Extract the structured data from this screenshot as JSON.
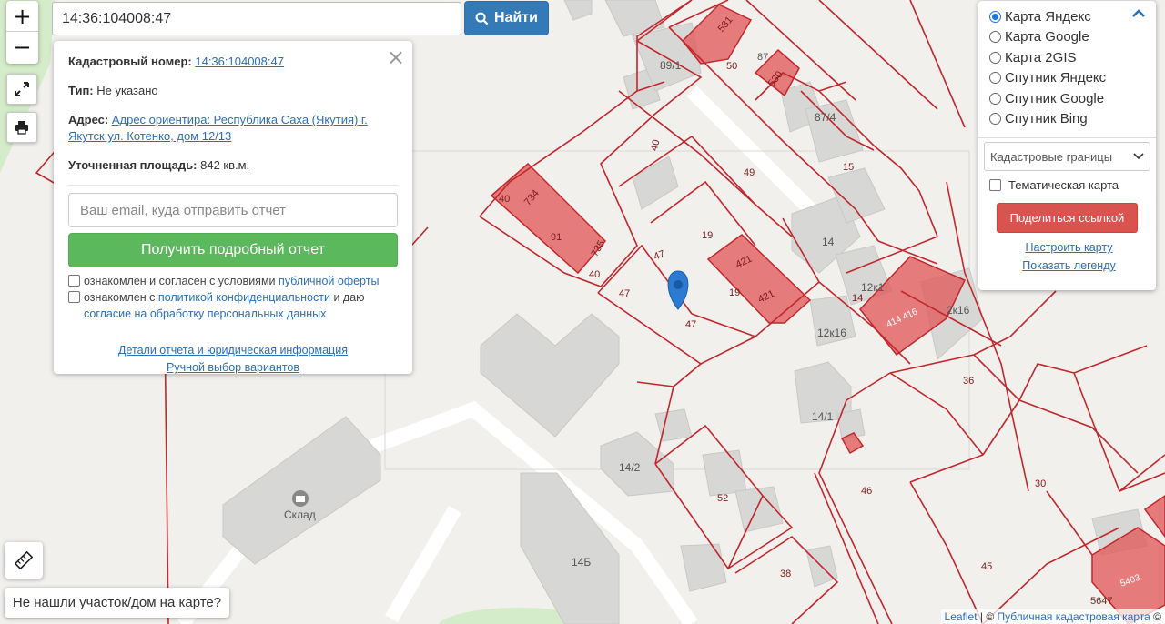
{
  "search": {
    "value": "14:36:104008:47",
    "button_label": "Найти"
  },
  "zoom": {
    "in": "+",
    "out": "−"
  },
  "info": {
    "cadastral_label": "Кадастровый номер:",
    "cadastral_value": "14:36:104008:47",
    "type_label": "Тип:",
    "type_value": "Не указано",
    "address_label": "Адрес:",
    "address_value": "Адрес ориентира: Республика Саха (Якутия) г. Якутск ул. Котенко, дом 12/13",
    "area_label": "Уточненная площадь:",
    "area_value": "842 кв.м.",
    "email_placeholder": "Ваш email, куда отправить отчет",
    "report_button": "Получить подробный отчет",
    "agree1_text": "ознакомлен и согласен с условиями",
    "agree1_link": "публичной оферты",
    "agree2_text": "ознакомлен с",
    "agree2_link1": "политикой конфиденциальности",
    "agree2_mid": "и даю",
    "agree2_link2": "согласие на обработку персональных данных",
    "details_link": "Детали отчета и юридическая информация",
    "manual_link": "Ручной выбор вариантов",
    "close": "×"
  },
  "layers": {
    "options": [
      {
        "label": "Карта Яндекс",
        "selected": true
      },
      {
        "label": "Карта Google",
        "selected": false
      },
      {
        "label": "Карта 2GIS",
        "selected": false
      },
      {
        "label": "Спутник Яндекс",
        "selected": false
      },
      {
        "label": "Спутник Google",
        "selected": false
      },
      {
        "label": "Спутник Bing",
        "selected": false
      }
    ],
    "select_value": "Кадастровые границы",
    "thematic_label": "Тематическая карта",
    "share_button": "Поделиться ссылкой",
    "configure_link": "Настроить карту",
    "legend_link": "Показать легенду"
  },
  "notfound_button": "Не нашли участок/дом на карте?",
  "attribution": {
    "leaflet": "Leaflet",
    "sep": " | © ",
    "pkk": "Публичная кадастровая карта",
    "tail": " ©"
  },
  "map_labels": {
    "l531": "531",
    "l530": "530",
    "l891": "89/1",
    "l50": "50",
    "l87": "87",
    "l874": "87/4",
    "l15": "15",
    "l40a": "40",
    "l49": "49",
    "l734": "734",
    "l40b": "40",
    "l91": "91",
    "l735": "735",
    "l40c": "40",
    "l19a": "19",
    "l47a": "47",
    "l421a": "421",
    "l19b": "19",
    "l421b": "421",
    "l14a": "14",
    "l12k1": "12к1",
    "l14b": "14",
    "l414": "414 416",
    "l2k16": "2к16",
    "l47b": "47",
    "l47c": "47",
    "l12k16": "12к16",
    "l36": "36",
    "l141": "14/1",
    "l142": "14/2",
    "l52": "52",
    "l46": "46",
    "l30": "30",
    "l14b2": "14Б",
    "l38": "38",
    "l45": "45",
    "l5647": "5647",
    "l5403": "5403",
    "sklad": "Склад"
  },
  "colors": {
    "accent_blue": "#337ab7",
    "green": "#5cb85c",
    "red": "#d9534f",
    "parcel_red": "#c1272d",
    "parcel_fill": "#e25b5b"
  }
}
